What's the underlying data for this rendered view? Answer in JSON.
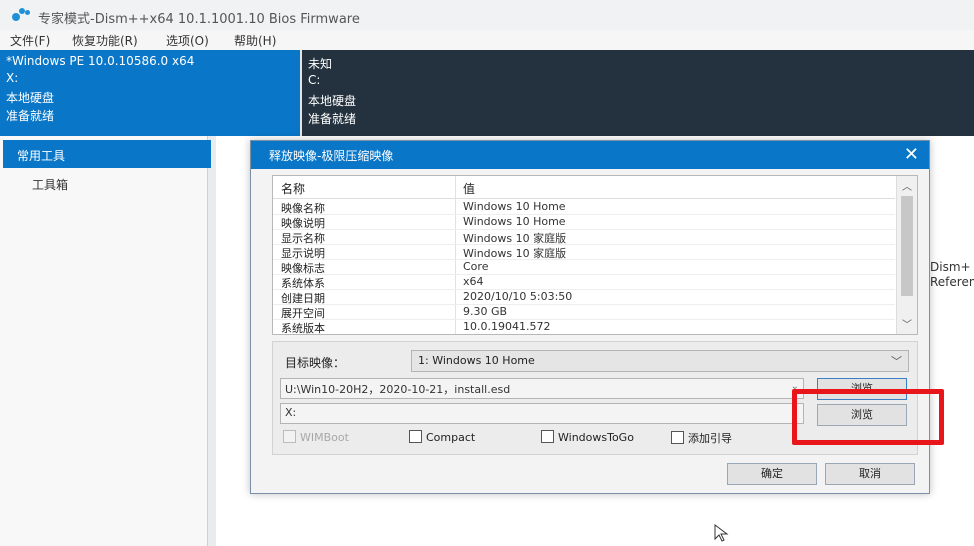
{
  "window": {
    "title": "专家模式-Dism++x64 10.1.1001.10 Bios Firmware"
  },
  "menu": [
    "文件(F)",
    "恢复功能(R)",
    "选项(O)",
    "帮助(H)"
  ],
  "systems": [
    {
      "name": "*Windows PE 10.0.10586.0 x64",
      "drive": "X:",
      "disk": "本地硬盘",
      "status": "准备就绪"
    },
    {
      "name": "未知",
      "drive": "C:",
      "disk": "本地硬盘",
      "status": "准备就绪"
    }
  ],
  "sidebar": {
    "category": "常用工具",
    "item": "工具箱"
  },
  "main_right_text": [
    "Dism+",
    "Referen"
  ],
  "dialog": {
    "title": "释放映像-极限压缩映像",
    "close": "✕",
    "table": {
      "headers": [
        "名称",
        "值"
      ],
      "rows": [
        [
          "映像名称",
          "Windows 10 Home"
        ],
        [
          "映像说明",
          "Windows 10 Home"
        ],
        [
          "显示名称",
          "Windows 10 家庭版"
        ],
        [
          "显示说明",
          "Windows 10 家庭版"
        ],
        [
          "映像标志",
          "Core"
        ],
        [
          "系统体系",
          "x64"
        ],
        [
          "创建日期",
          "2020/10/10 5:03:50"
        ],
        [
          "展开空间",
          "9.30 GB"
        ],
        [
          "系统版本",
          "10.0.19041.572"
        ]
      ]
    },
    "target_label": "目标映像：",
    "target_value": "1: Windows 10 Home",
    "source_path": "U:\\Win10-20H2，2020-10-21，install.esd",
    "browse1": "浏览",
    "dest_path": "X:",
    "browse2": "浏览",
    "checkboxes": [
      "WIMBoot",
      "Compact",
      "WindowsToGo",
      "添加引导"
    ],
    "ok": "确定",
    "cancel": "取消"
  },
  "colors": {
    "accent": "#0a76c8",
    "highlight": "#e8161a",
    "dark_panel": "#24323f"
  }
}
